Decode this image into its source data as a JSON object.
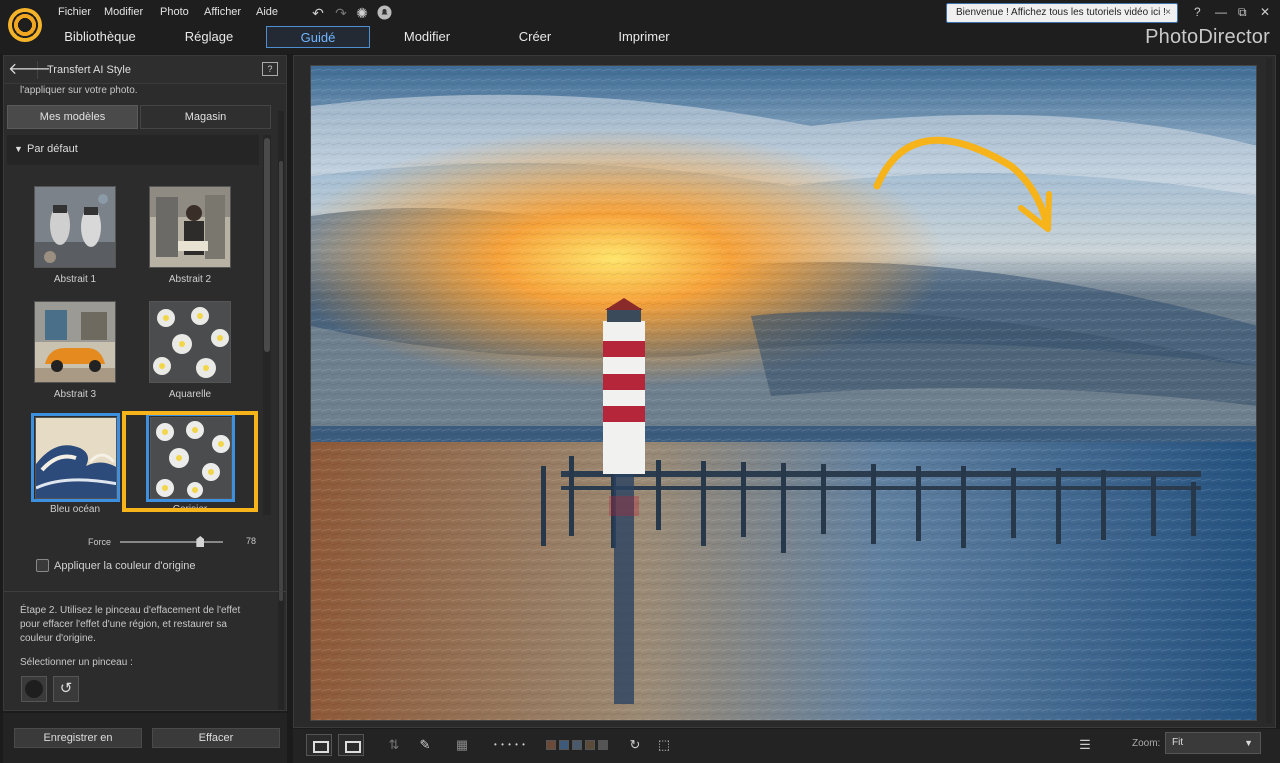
{
  "menubar": {
    "items": [
      "Fichier",
      "Modifier",
      "Photo",
      "Afficher",
      "Aide"
    ],
    "welcome_text": "Bienvenue ! Affichez tous les tutoriels vidéo ici !",
    "welcome_close": "×",
    "help": "?",
    "minimize": "—",
    "maximize": "⧉",
    "close": "✕",
    "icons": [
      "undo-icon",
      "redo-icon",
      "settings-icon",
      "notification-icon"
    ]
  },
  "tabs": {
    "items": [
      "Bibliothèque",
      "Réglage",
      "Guidé",
      "Modifier",
      "Créer",
      "Imprimer"
    ],
    "active": "Guidé",
    "brand": "PhotoDirector"
  },
  "panel": {
    "title": "Transfert AI Style",
    "help": "?",
    "intro": "l'appliquer sur votre photo.",
    "tab_mine": "Mes modèles",
    "tab_store": "Magasin",
    "group": "Par défaut",
    "styles": [
      {
        "label": "Abstrait 1"
      },
      {
        "label": "Abstrait 2"
      },
      {
        "label": "Abstrait 3"
      },
      {
        "label": "Aquarelle"
      },
      {
        "label": "Bleu océan"
      },
      {
        "label": "Cerisier"
      }
    ],
    "force_label": "Force",
    "force_value": "78",
    "force_fraction": 0.78,
    "apply_original": "Appliquer la couleur d'origine",
    "step2": "Étape 2. Utilisez le pinceau d'effacement de l'effet pour effacer l'effet d'une région, et restaurer sa couleur d'origine.",
    "brush_label": "Sélectionner un pinceau :",
    "save_button": "Enregistrer en",
    "clear_button": "Effacer"
  },
  "toolbar": {
    "zoom_label": "Zoom:",
    "zoom_value": "Fit",
    "dots": "• • • • •",
    "swatch_colors": [
      "#6b4a3a",
      "#3d5a7a",
      "#4a5a6a",
      "#5a4a3a",
      "#555555"
    ]
  },
  "colors": {
    "accent": "#4f8fd0",
    "highlight": "#f6b31a",
    "background": "#1b1b1b"
  }
}
